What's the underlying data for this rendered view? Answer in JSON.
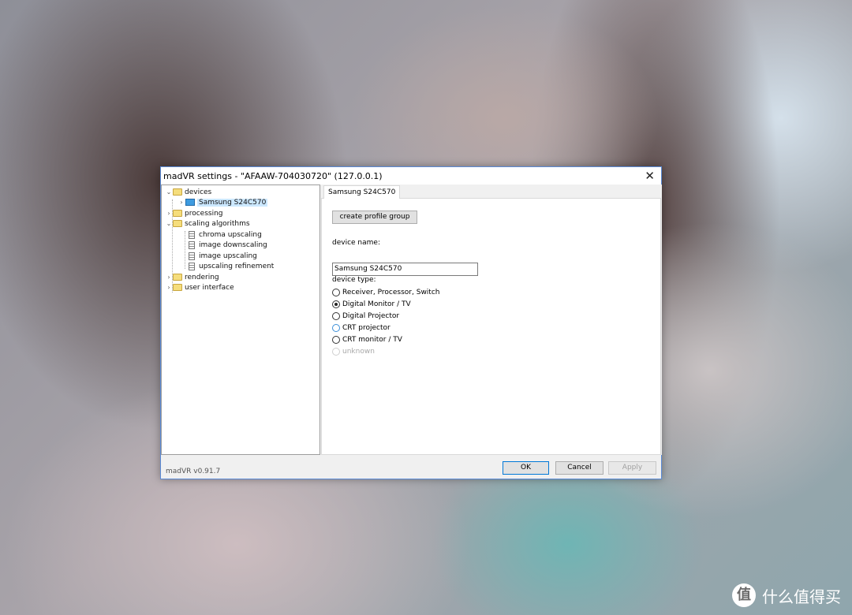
{
  "window": {
    "title": "madVR settings - \"AFAAW-704030720\" (127.0.0.1)",
    "close_glyph": "✕",
    "version": "madVR v0.91.7"
  },
  "tree": {
    "devices": "devices",
    "device_entry": "Samsung S24C570",
    "processing": "processing",
    "scaling_algorithms": "scaling algorithms",
    "chroma_upscaling": "chroma upscaling",
    "image_downscaling": "image downscaling",
    "image_upscaling": "image upscaling",
    "upscaling_refinement": "upscaling refinement",
    "rendering": "rendering",
    "user_interface": "user interface",
    "expand_glyph": "›",
    "collapse_glyph": "⌄"
  },
  "panel": {
    "tab_label": "Samsung S24C570",
    "create_profile_group": "create profile group",
    "device_name_label": "device name:",
    "device_name_value": "Samsung S24C570",
    "device_type_label": "device type:",
    "device_types": [
      "Receiver, Processor, Switch",
      "Digital Monitor / TV",
      "Digital Projector",
      "CRT projector",
      "CRT monitor / TV",
      "unknown"
    ],
    "selected_device_type": "Digital Monitor / TV"
  },
  "buttons": {
    "ok": "OK",
    "cancel": "Cancel",
    "apply": "Apply"
  },
  "watermark": {
    "logo_glyph": "值",
    "text": "什么值得买"
  }
}
